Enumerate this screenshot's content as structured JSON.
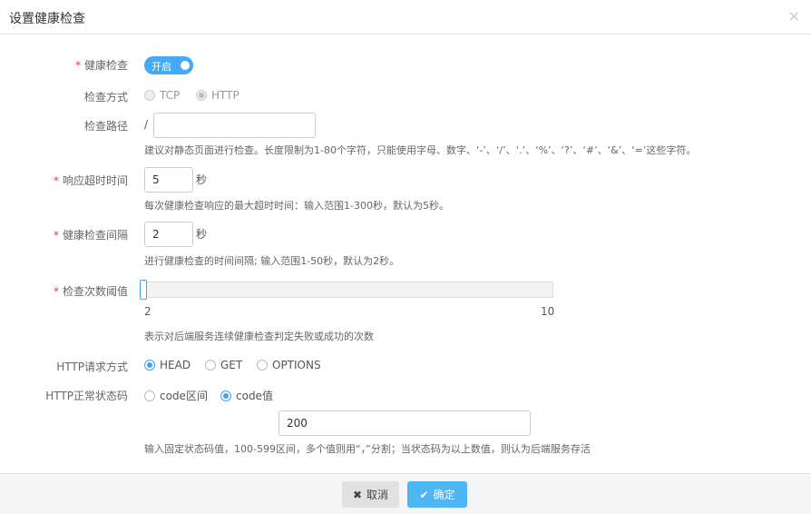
{
  "dialog": {
    "title": "设置健康检查",
    "close_icon": "×"
  },
  "form": {
    "health_check": {
      "label": "健康检查",
      "toggle_label": "开启",
      "enabled": true
    },
    "check_method": {
      "label": "检查方式",
      "options": [
        "TCP",
        "HTTP"
      ],
      "selected": "HTTP",
      "disabled": true
    },
    "check_path": {
      "label": "检查路径",
      "prefix": "/",
      "value": "",
      "hint": "建议对静态页面进行检查。长度限制为1-80个字符，只能使用字母、数字、‘-’、‘/’、‘.’、‘%’、‘?’、‘#’、‘&’、‘=’这些字符。"
    },
    "response_timeout": {
      "label": "响应超时时间",
      "value": "5",
      "unit": "秒",
      "hint": "每次健康检查响应的最大超时时间：输入范围1-300秒，默认为5秒。"
    },
    "check_interval": {
      "label": "健康检查间隔",
      "value": "2",
      "unit": "秒",
      "hint": "进行健康检查的时间间隔; 输入范围1-50秒，默认为2秒。"
    },
    "check_threshold": {
      "label": "检查次数阈值",
      "min": "2",
      "max": "10",
      "value": 2,
      "hint": "表示对后端服务连续健康检查判定失败或成功的次数"
    },
    "http_method": {
      "label": "HTTP请求方式",
      "options": [
        "HEAD",
        "GET",
        "OPTIONS"
      ],
      "selected": "HEAD"
    },
    "http_status": {
      "label": "HTTP正常状态码",
      "options": [
        "code区间",
        "code值"
      ],
      "selected": "code值",
      "value": "200",
      "hint": "输入固定状态码值，100-599区间，多个值则用“，”分割；当状态码为以上数值，则认为后端服务存活"
    }
  },
  "footer": {
    "cancel_label": "取消",
    "cancel_icon": "✖",
    "ok_label": "确定",
    "ok_icon": "✔"
  },
  "colors": {
    "accent": "#3fa2ef",
    "required": "#e4393c",
    "ok_button": "#4eb6f5",
    "cancel_button": "#e1e1e1"
  }
}
